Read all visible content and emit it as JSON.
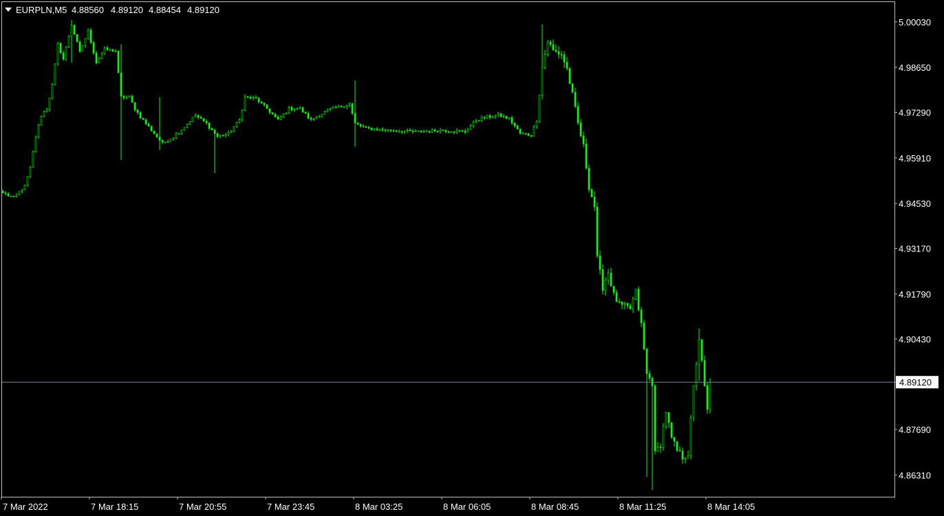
{
  "colors": {
    "background": "#000000",
    "frame": "#c0c0c0",
    "candle": "#00ff00",
    "current_price_line": "#778899",
    "text": "#ffffff",
    "current_price_box_bg": "#ffffff",
    "current_price_box_text": "#000000"
  },
  "header": {
    "dropdown_icon": "triangle-down-icon",
    "symbol": "EURPLN,M5",
    "open": "4.88560",
    "high": "4.89120",
    "low": "4.88454",
    "close": "4.89120"
  },
  "current_price": {
    "value": 4.8912,
    "label": "4.89120"
  },
  "chart_data": {
    "type": "candlestick",
    "symbol": "EURPLN",
    "timeframe": "M5",
    "ylim": [
      4.8565,
      5.0063
    ],
    "grid": false,
    "y_ticks": [
      "5.00030",
      "4.98650",
      "4.97290",
      "4.95910",
      "4.94530",
      "4.93170",
      "4.91790",
      "4.90430",
      "4.89120",
      "4.87690",
      "4.86310"
    ],
    "y_tick_values": [
      5.0003,
      4.9865,
      4.9729,
      4.9591,
      4.9453,
      4.9317,
      4.9179,
      4.9043,
      4.8912,
      4.8769,
      4.8631
    ],
    "x_ticks": [
      "7 Mar 2022",
      "7 Mar 18:15",
      "7 Mar 20:55",
      "7 Mar 23:45",
      "8 Mar 03:25",
      "8 Mar 06:05",
      "8 Mar 08:45",
      "8 Mar 11:25",
      "8 Mar 14:05"
    ],
    "x_tick_bar_index": [
      0,
      32,
      64,
      96,
      128,
      160,
      192,
      224,
      256
    ],
    "bars_count": 258,
    "close_path": [
      [
        0,
        4.9485
      ],
      [
        4,
        4.947
      ],
      [
        8,
        4.9505
      ],
      [
        10,
        4.956
      ],
      [
        12,
        4.9655
      ],
      [
        14,
        4.972
      ],
      [
        16,
        4.974
      ],
      [
        18,
        4.981
      ],
      [
        20,
        4.9935
      ],
      [
        22,
        4.989
      ],
      [
        25,
        4.9995
      ],
      [
        28,
        4.991
      ],
      [
        31,
        4.9975
      ],
      [
        34,
        4.988
      ],
      [
        37,
        4.992
      ],
      [
        41,
        4.9915
      ],
      [
        43,
        4.9775
      ],
      [
        46,
        4.9775
      ],
      [
        48,
        4.974
      ],
      [
        50,
        4.9715
      ],
      [
        54,
        4.9675
      ],
      [
        58,
        4.9635
      ],
      [
        62,
        4.9655
      ],
      [
        66,
        4.9685
      ],
      [
        70,
        4.972
      ],
      [
        74,
        4.9695
      ],
      [
        78,
        4.9655
      ],
      [
        82,
        4.9665
      ],
      [
        86,
        4.9705
      ],
      [
        88,
        4.9775
      ],
      [
        92,
        4.977
      ],
      [
        96,
        4.974
      ],
      [
        100,
        4.9705
      ],
      [
        104,
        4.974
      ],
      [
        108,
        4.974
      ],
      [
        112,
        4.9705
      ],
      [
        118,
        4.9735
      ],
      [
        122,
        4.9745
      ],
      [
        126,
        4.9755
      ],
      [
        128,
        4.9695
      ],
      [
        132,
        4.968
      ],
      [
        140,
        4.9675
      ],
      [
        150,
        4.967
      ],
      [
        160,
        4.9675
      ],
      [
        168,
        4.967
      ],
      [
        172,
        4.9705
      ],
      [
        176,
        4.9715
      ],
      [
        180,
        4.972
      ],
      [
        184,
        4.971
      ],
      [
        188,
        4.9665
      ],
      [
        192,
        4.966
      ],
      [
        194,
        4.9705
      ],
      [
        196,
        4.9865
      ],
      [
        198,
        4.9945
      ],
      [
        200,
        4.9915
      ],
      [
        203,
        4.9905
      ],
      [
        205,
        4.986
      ],
      [
        207,
        4.978
      ],
      [
        209,
        4.9695
      ],
      [
        211,
        4.9625
      ],
      [
        213,
        4.9505
      ],
      [
        215,
        4.9445
      ],
      [
        216,
        4.9285
      ],
      [
        218,
        4.92
      ],
      [
        220,
        4.9245
      ],
      [
        222,
        4.9175
      ],
      [
        224,
        4.9145
      ],
      [
        228,
        4.9135
      ],
      [
        230,
        4.9185
      ],
      [
        232,
        4.9085
      ],
      [
        234,
        4.8935
      ],
      [
        236,
        4.891
      ],
      [
        237,
        4.8695
      ],
      [
        239,
        4.8725
      ],
      [
        241,
        4.8825
      ],
      [
        243,
        4.874
      ],
      [
        245,
        4.8705
      ],
      [
        247,
        4.8685
      ],
      [
        249,
        4.8695
      ],
      [
        251,
        4.8895
      ],
      [
        253,
        4.9045
      ],
      [
        255,
        4.8895
      ],
      [
        256,
        4.8825
      ],
      [
        257,
        4.8912
      ]
    ],
    "spikes": [
      {
        "i": 25,
        "high": 5.0008,
        "low": 4.988
      },
      {
        "i": 43,
        "high": 4.9935,
        "low": 4.9585
      },
      {
        "i": 57,
        "high": 4.9775,
        "low": 4.9615
      },
      {
        "i": 77,
        "high": 4.968,
        "low": 4.9545
      },
      {
        "i": 128,
        "high": 4.9825,
        "low": 4.9625
      },
      {
        "i": 196,
        "high": 4.9995,
        "low": 4.9795
      },
      {
        "i": 234,
        "high": 4.8955,
        "low": 4.8625
      },
      {
        "i": 236,
        "high": 4.8875,
        "low": 4.8585
      },
      {
        "i": 253,
        "high": 4.9075,
        "low": 4.8915
      }
    ]
  }
}
